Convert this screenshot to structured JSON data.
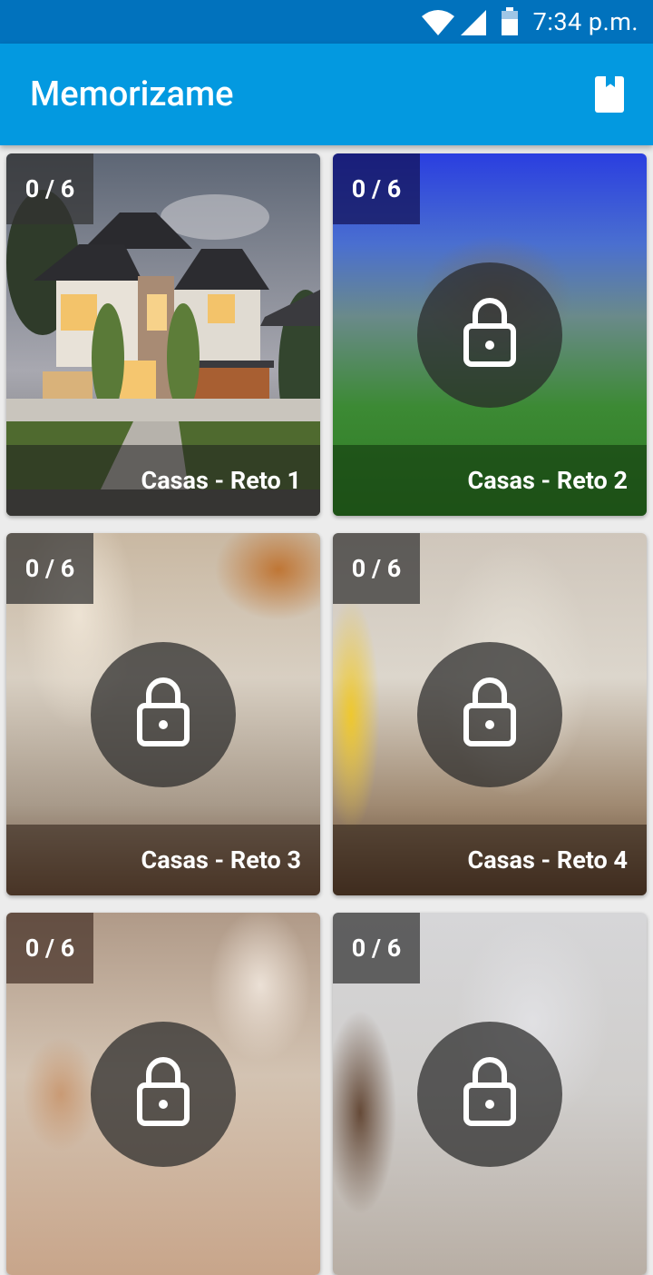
{
  "status_bar": {
    "time": "7:34 p.m.",
    "icons": [
      "wifi-icon",
      "signal-icon",
      "battery-icon"
    ]
  },
  "app_bar": {
    "title": "Memorizame",
    "action_icon": "bookmark-icon"
  },
  "cards": [
    {
      "title": "Casas - Reto 1",
      "progress": "0 / 6",
      "locked": false
    },
    {
      "title": "Casas - Reto 2",
      "progress": "0 / 6",
      "locked": true
    },
    {
      "title": "Casas - Reto 3",
      "progress": "0 / 6",
      "locked": true
    },
    {
      "title": "Casas - Reto 4",
      "progress": "0 / 6",
      "locked": true
    },
    {
      "title": "",
      "progress": "0 / 6",
      "locked": true
    },
    {
      "title": "",
      "progress": "0 / 6",
      "locked": true
    }
  ],
  "colors": {
    "status_bar": "#0172bd",
    "app_bar": "#0399e0",
    "background": "#ececec"
  }
}
